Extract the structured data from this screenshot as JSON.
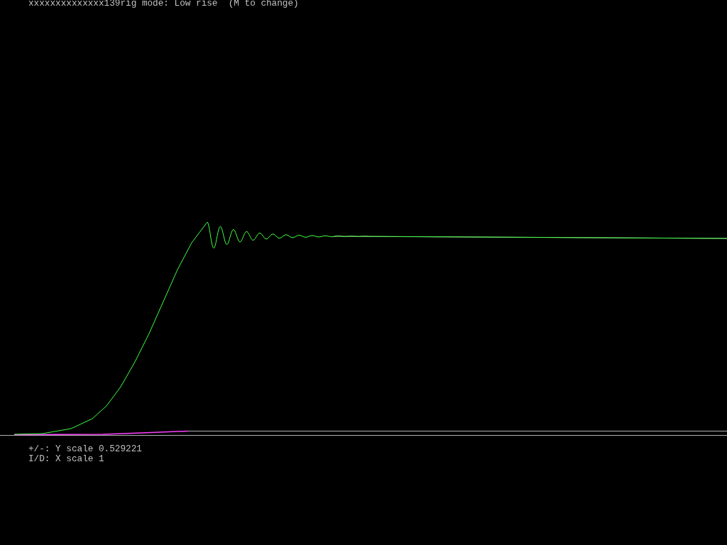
{
  "status_line": "xxxxxxxxxxxxxx139rig mode: Low rise  (M to change)",
  "help_lines": [
    "+/-: Y scale 0.529221",
    "I/D: X scale 1"
  ]
}
